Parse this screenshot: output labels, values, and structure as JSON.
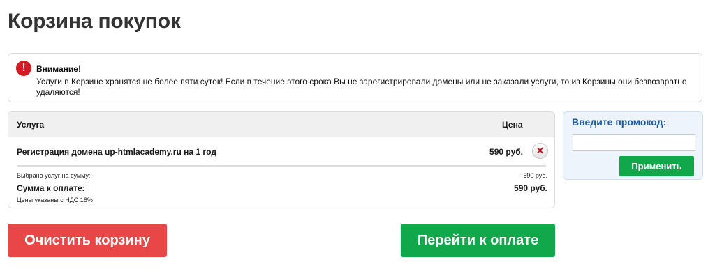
{
  "page": {
    "title": "Корзина покупок"
  },
  "notice": {
    "icon": "exclamation-icon",
    "icon_glyph": "!",
    "title": "Внимание!",
    "text": "Услуги в Корзине хранятся не более пяти суток! Если в течение этого срока Вы не зарегистрировали домены или не заказали услуги, то из Корзины они безвозвратно удаляются!",
    "color": "#d71921"
  },
  "cart": {
    "columns": {
      "service": "Услуга",
      "price": "Цена"
    },
    "items": [
      {
        "name": "Регистрация домена up-htmlacademy.ru на 1 год",
        "price": "590 руб.",
        "remove_icon": "close-icon",
        "remove_glyph": "✕"
      }
    ],
    "summary": {
      "selected_label": "Выбрано услуг на сумму:",
      "selected_value": "590 руб.",
      "total_label": "Сумма к оплате:",
      "total_value": "590 руб.",
      "vat_note": "Цены указаны с НДС 18%"
    }
  },
  "promo": {
    "title": "Введите промокод:",
    "input_value": "",
    "apply_label": "Применить"
  },
  "actions": {
    "clear_label": "Очистить корзину",
    "checkout_label": "Перейти к оплате"
  },
  "colors": {
    "accent_green": "#10a84b",
    "accent_red": "#e94747",
    "promo_title": "#1e5aa0"
  }
}
